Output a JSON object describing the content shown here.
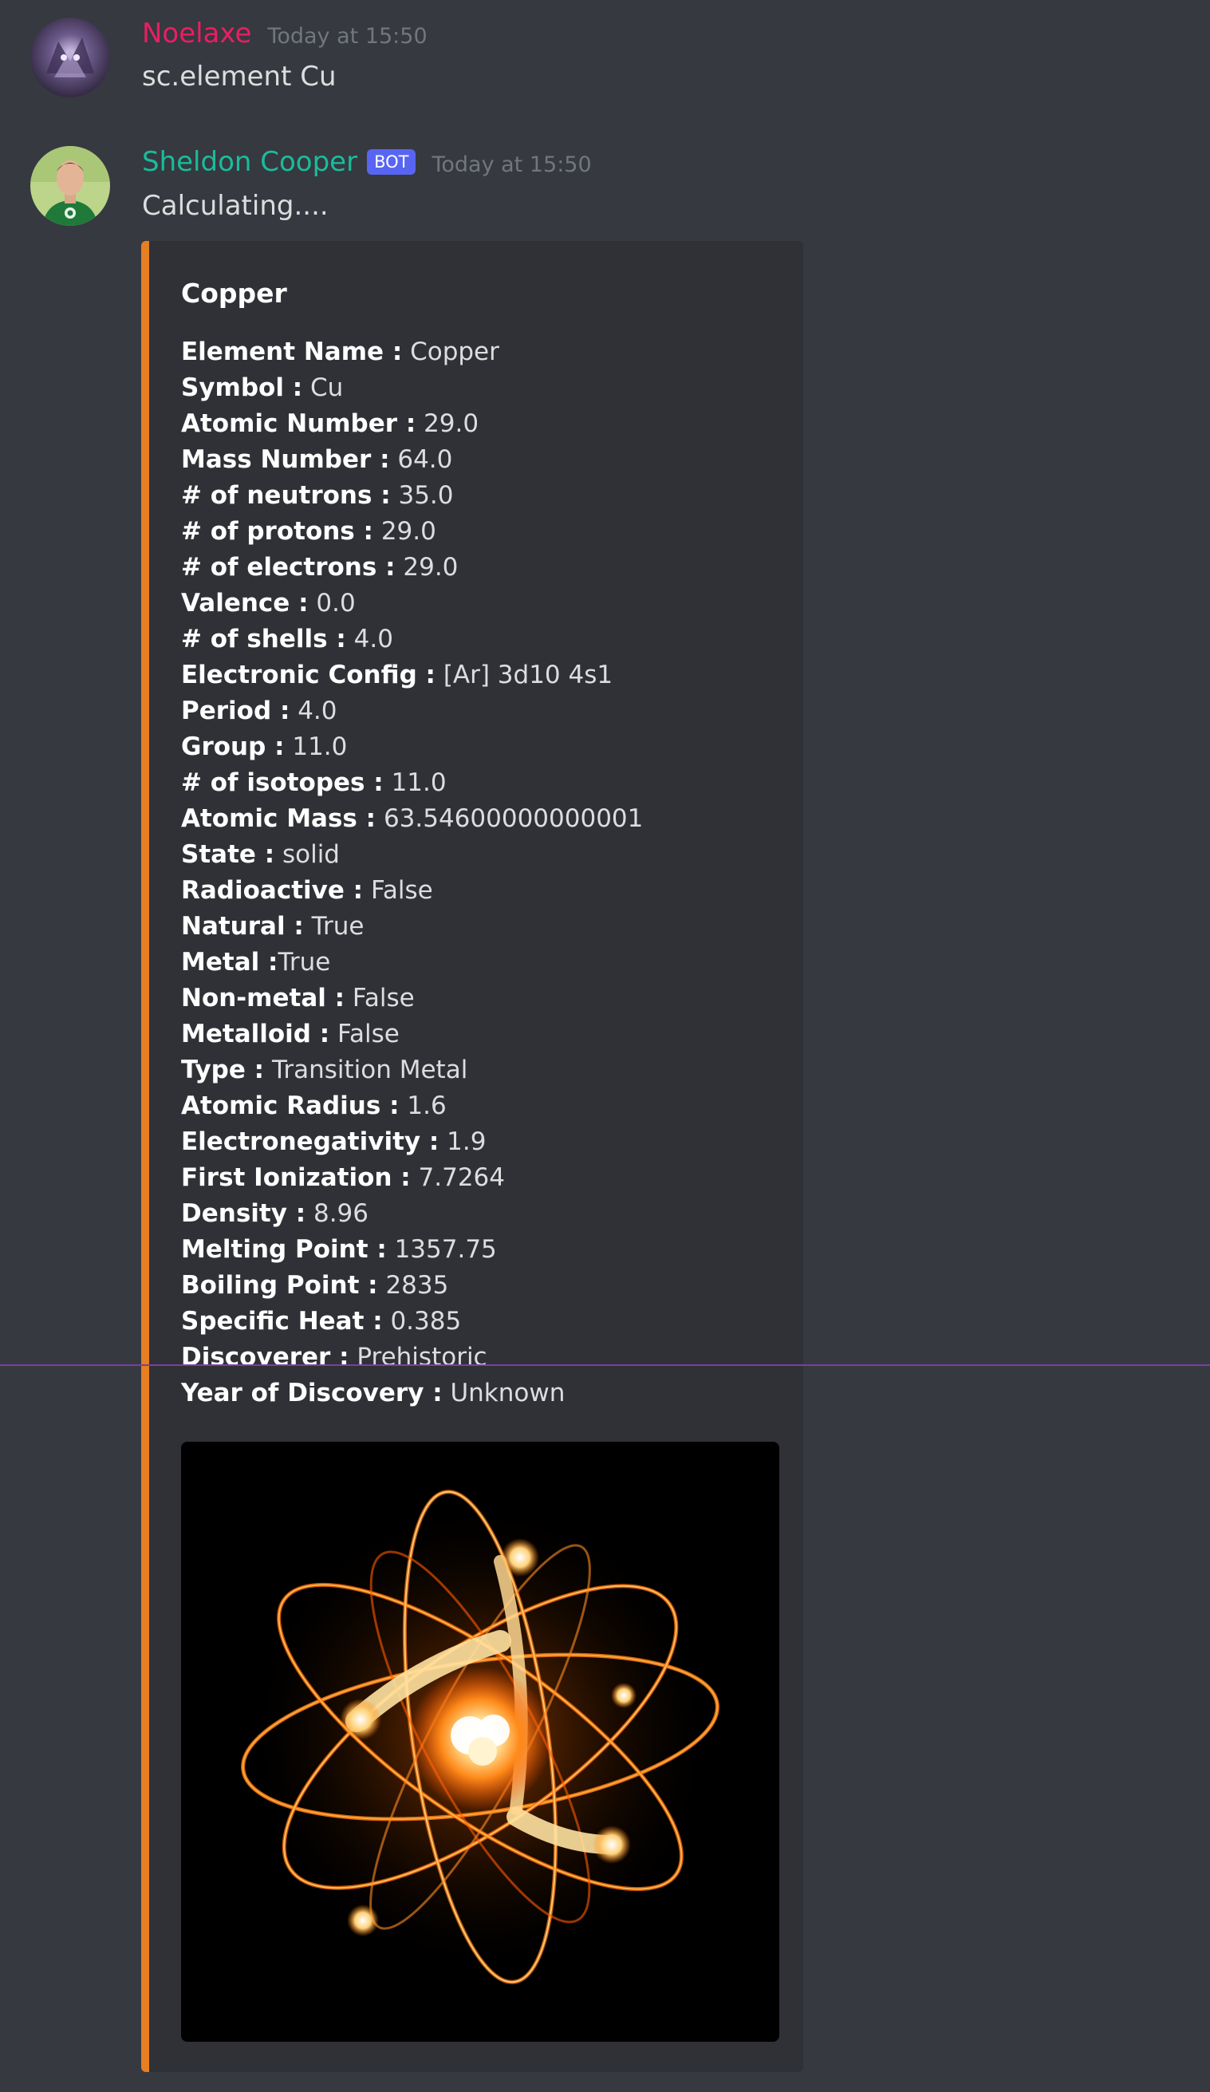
{
  "colors": {
    "background": "#36393f",
    "embed_background": "#2f3136",
    "embed_accent": "#e67e22",
    "user1_name": "#e91e63",
    "user2_name": "#1abc9c",
    "bot_tag": "#5865f2",
    "timestamp": "#72767d"
  },
  "messages": [
    {
      "author": "Noelaxe",
      "timestamp": "Today at 15:50",
      "text": "sc.element Cu",
      "avatar_icon": "purple-dragon-avatar-icon"
    },
    {
      "author": "Sheldon Cooper",
      "bot_tag": "BOT",
      "timestamp": "Today at 15:50",
      "text": "Calculating....",
      "avatar_icon": "sheldon-avatar-icon"
    }
  ],
  "embed": {
    "title": "Copper",
    "image_icon": "glowing-atom-image",
    "fields": [
      {
        "label": "Element Name :",
        "value": "Copper"
      },
      {
        "label": "Symbol :",
        "value": "Cu"
      },
      {
        "label": "Atomic Number :",
        "value": "29.0"
      },
      {
        "label": "Mass Number :",
        "value": "64.0"
      },
      {
        "label": "# of neutrons :",
        "value": "35.0"
      },
      {
        "label": "# of protons :",
        "value": "29.0"
      },
      {
        "label": "# of electrons :",
        "value": "29.0"
      },
      {
        "label": "Valence :",
        "value": "0.0"
      },
      {
        "label": "# of shells :",
        "value": "4.0"
      },
      {
        "label": "Electronic Config :",
        "value": "[Ar] 3d10 4s1"
      },
      {
        "label": "Period :",
        "value": "4.0"
      },
      {
        "label": "Group :",
        "value": "11.0"
      },
      {
        "label": "# of isotopes :",
        "value": "11.0"
      },
      {
        "label": "Atomic Mass :",
        "value": "63.54600000000001"
      },
      {
        "label": "State :",
        "value": "solid"
      },
      {
        "label": "Radioactive :",
        "value": "False"
      },
      {
        "label": "Natural :",
        "value": "True"
      },
      {
        "label": "Metal :",
        "value": "True"
      },
      {
        "label": "Non-metal :",
        "value": "False"
      },
      {
        "label": "Metalloid :",
        "value": "False"
      },
      {
        "label": "Type :",
        "value": "Transition Metal"
      },
      {
        "label": "Atomic Radius :",
        "value": "1.6"
      },
      {
        "label": "Electronegativity :",
        "value": "1.9"
      },
      {
        "label": "First Ionization :",
        "value": "7.7264"
      },
      {
        "label": "Density :",
        "value": "8.96"
      },
      {
        "label": "Melting Point :",
        "value": "1357.75"
      },
      {
        "label": "Boiling Point :",
        "value": "2835"
      },
      {
        "label": "Specific Heat :",
        "value": "0.385"
      },
      {
        "label": "Discoverer :",
        "value": "Prehistoric"
      },
      {
        "label": "Year of Discovery :",
        "value": "Unknown"
      }
    ]
  }
}
